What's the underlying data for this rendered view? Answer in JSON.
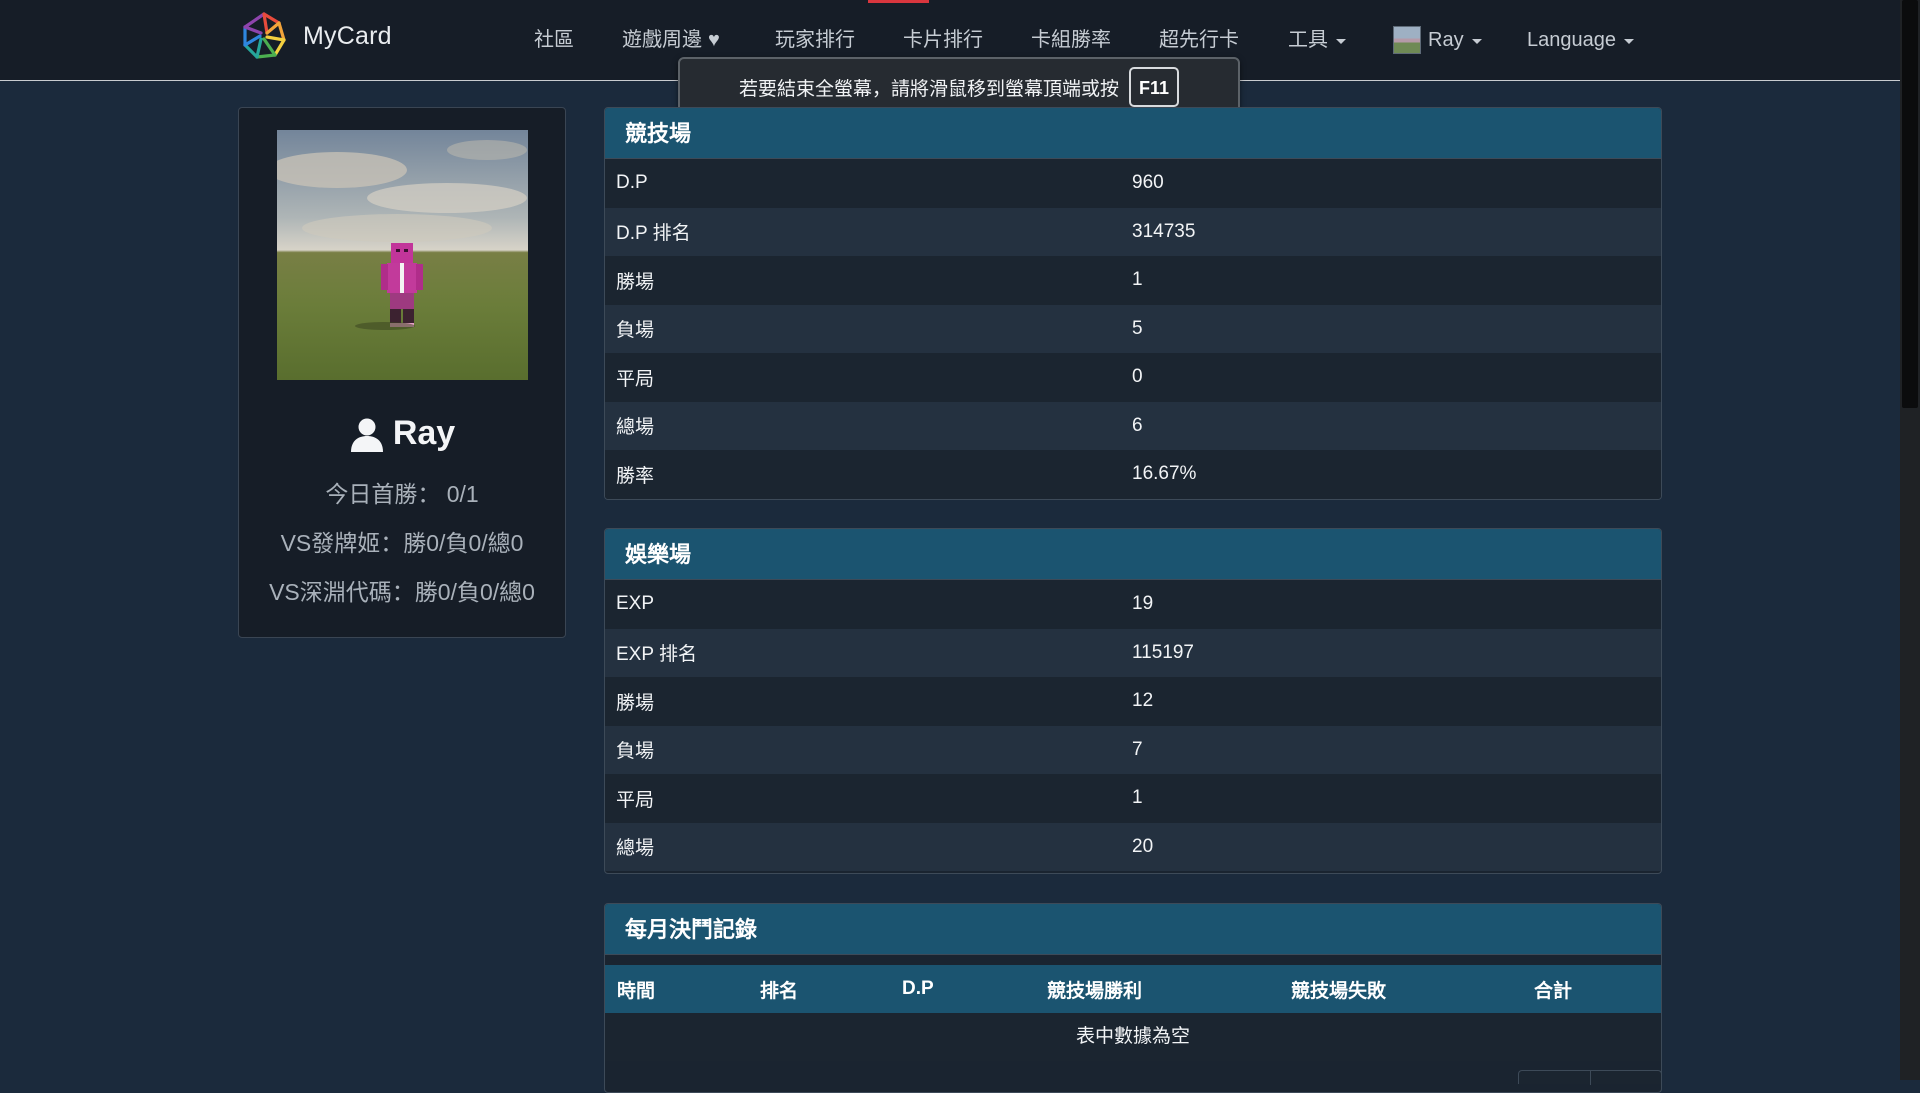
{
  "brand": {
    "name": "MyCard"
  },
  "nav": {
    "community": "社區",
    "merch": "遊戲周邊",
    "player_rank": "玩家排行",
    "card_rank": "卡片排行",
    "deck_winrate": "卡組勝率",
    "early_cards": "超先行卡",
    "tools": "工具",
    "user": "Ray",
    "language": "Language"
  },
  "fullscreen_notice": {
    "text": "若要結束全螢幕，請將滑鼠移到螢幕頂端或按",
    "key": "F11"
  },
  "profile": {
    "username": "Ray",
    "first_win_today": "今日首勝： 0/1",
    "vs_dealer": "VS發牌姬：勝0/負0/總0",
    "vs_abyss": "VS深淵代碼：勝0/負0/總0"
  },
  "arena": {
    "title": "競技場",
    "rows": [
      {
        "label": "D.P",
        "value": "960"
      },
      {
        "label": "D.P 排名",
        "value": "314735"
      },
      {
        "label": "勝場",
        "value": "1"
      },
      {
        "label": "負場",
        "value": "5"
      },
      {
        "label": "平局",
        "value": "0"
      },
      {
        "label": "總場",
        "value": "6"
      },
      {
        "label": "勝率",
        "value": "16.67%"
      }
    ]
  },
  "entertainment": {
    "title": "娛樂場",
    "rows": [
      {
        "label": "EXP",
        "value": "19"
      },
      {
        "label": "EXP 排名",
        "value": "115197"
      },
      {
        "label": "勝場",
        "value": "12"
      },
      {
        "label": "負場",
        "value": "7"
      },
      {
        "label": "平局",
        "value": "1"
      },
      {
        "label": "總場",
        "value": "20"
      }
    ]
  },
  "monthly": {
    "title": "每月決鬥記錄",
    "columns": [
      "時間",
      "排名",
      "D.P",
      "競技場勝利",
      "競技場失敗",
      "合計"
    ],
    "empty_text": "表中數據為空"
  },
  "colors": {
    "page_bg": "#1b2a3c",
    "navbar_bg": "#161d27",
    "panel_header": "#1b5470",
    "row_odd": "#1b2530",
    "row_even": "#243140",
    "accent_red": "#d9363e"
  }
}
